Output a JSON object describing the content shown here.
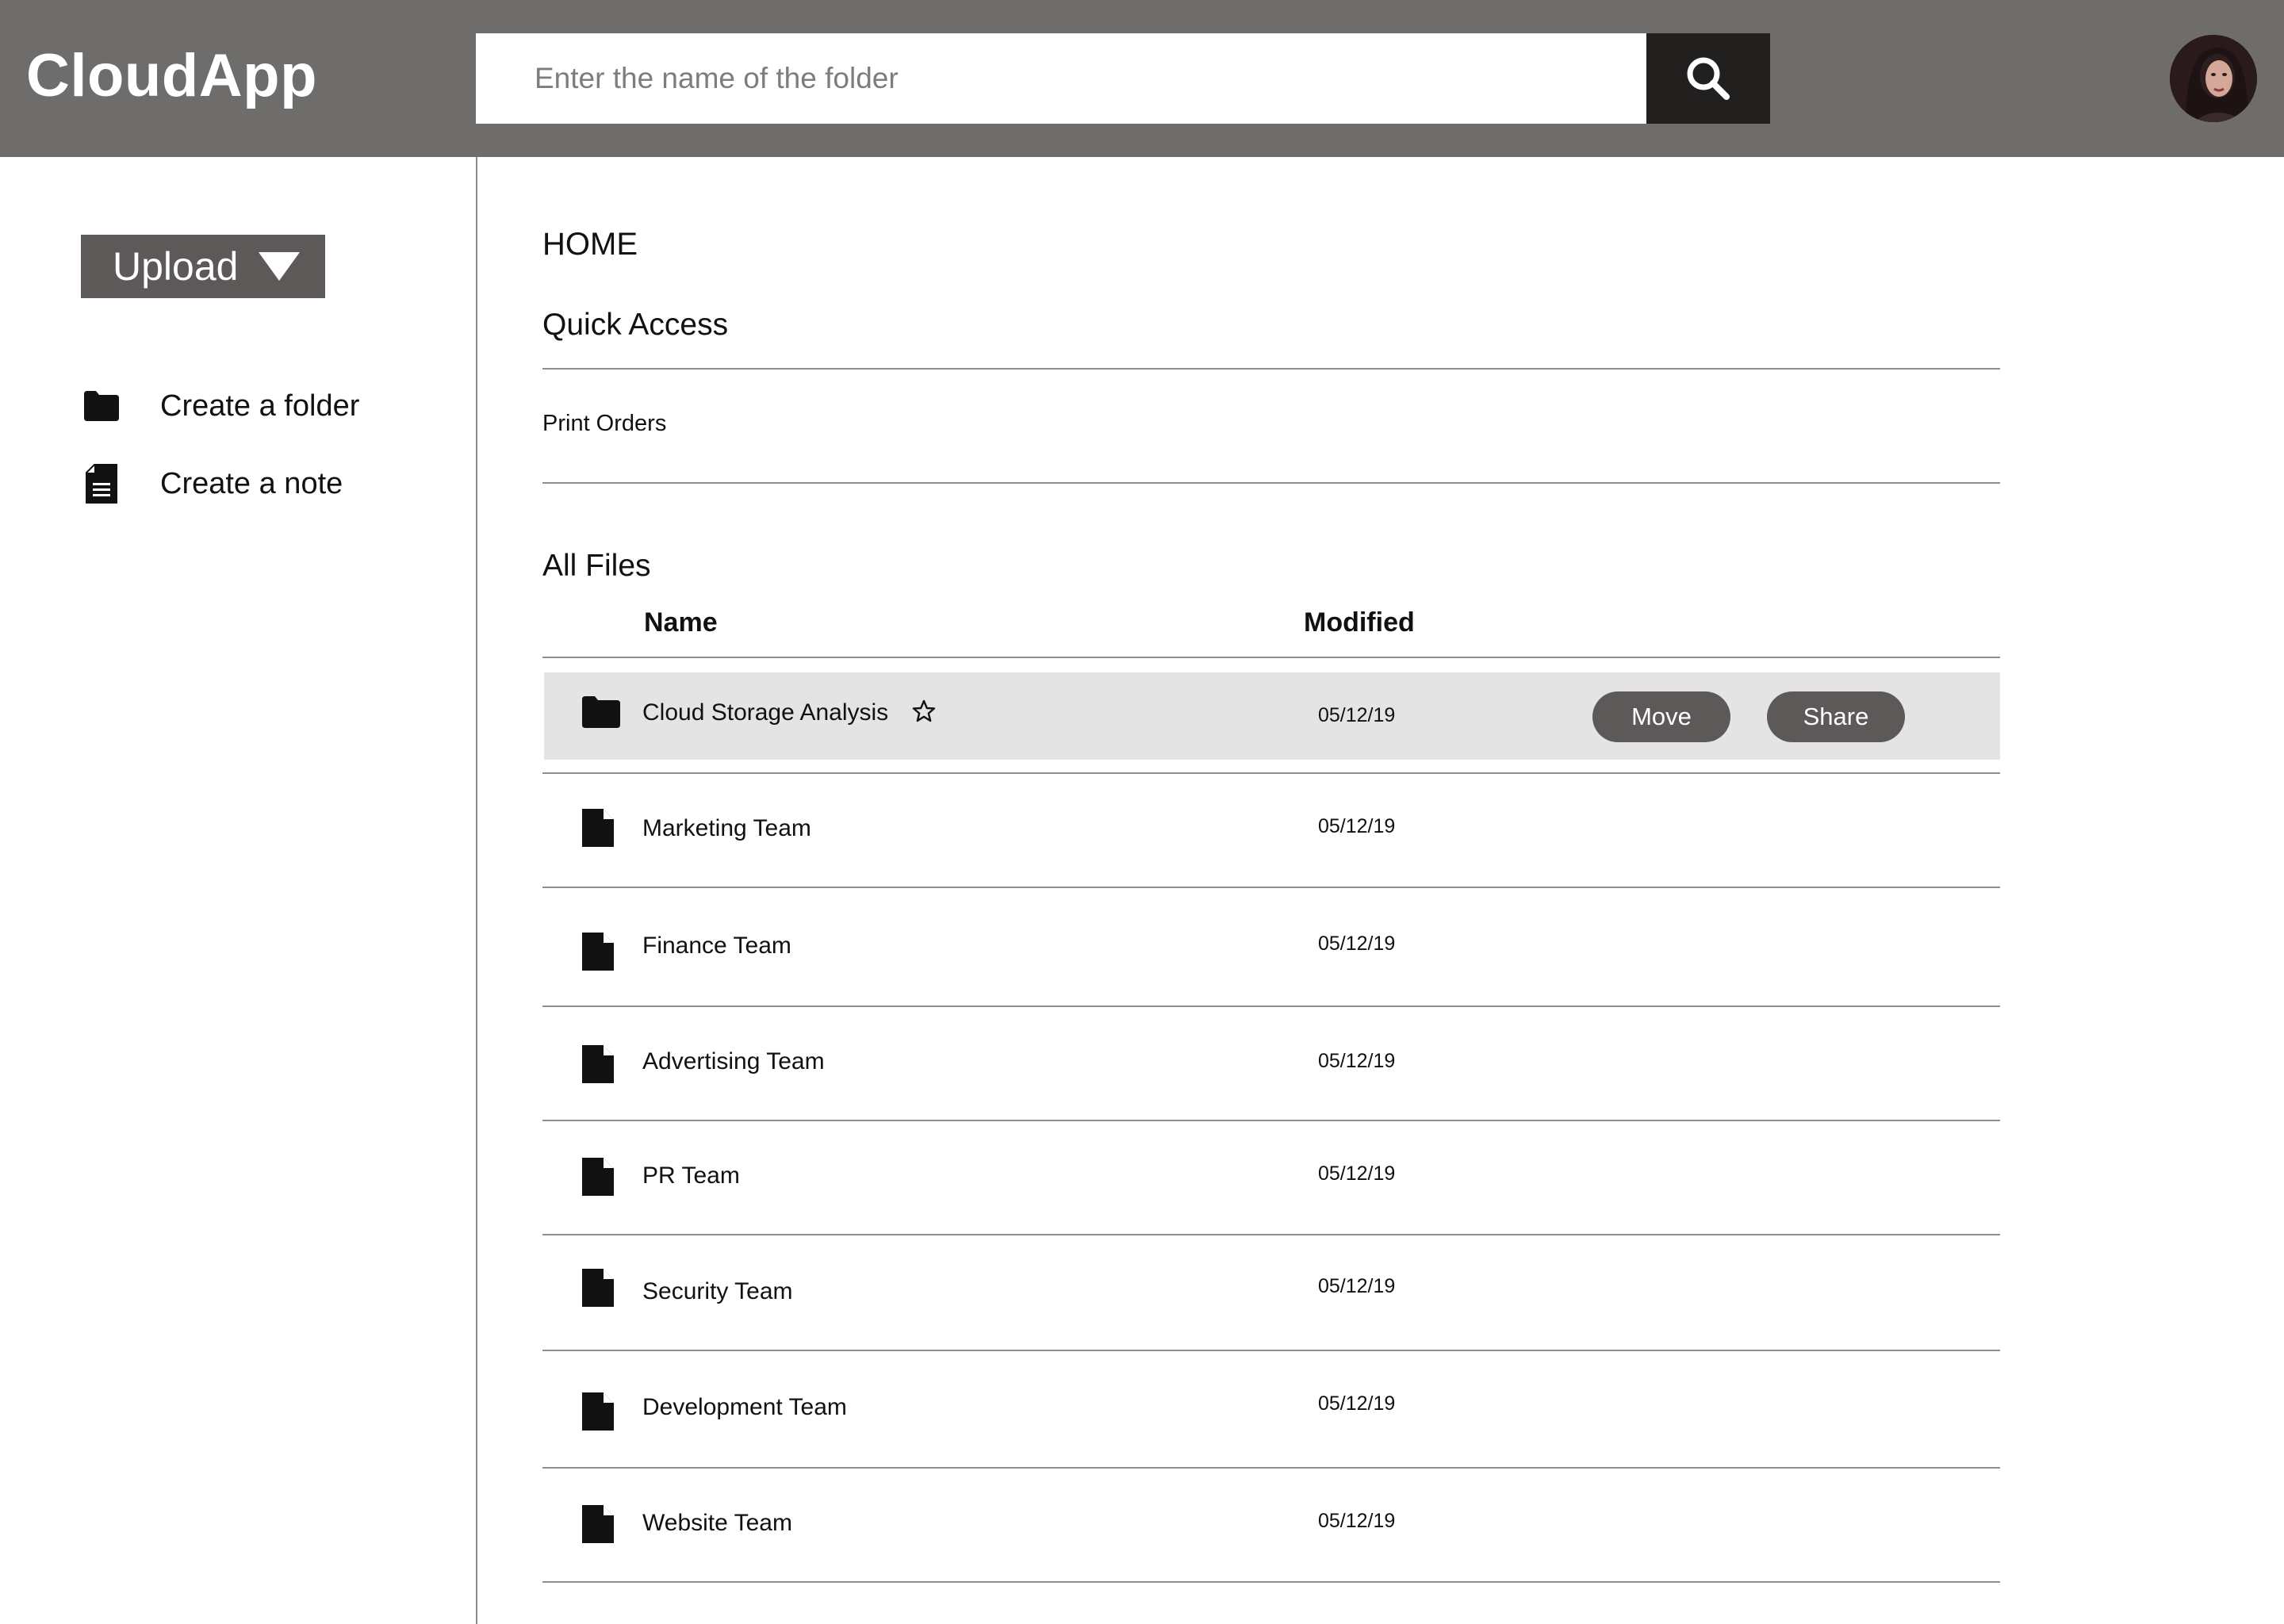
{
  "header": {
    "brand": "CloudApp",
    "search_placeholder": "Enter the name of the folder",
    "search_icon": "search-icon",
    "avatar": "user-avatar"
  },
  "sidebar": {
    "upload_label": "Upload",
    "upload_icon": "caret-down-icon",
    "actions": [
      {
        "label": "Create a folder",
        "icon": "folder-icon"
      },
      {
        "label": "Create a note",
        "icon": "note-icon"
      }
    ]
  },
  "main": {
    "home_title": "HOME",
    "quick_access": {
      "title": "Quick Access",
      "items": [
        "Print Orders"
      ]
    },
    "all_files": {
      "title": "All Files",
      "columns": {
        "name": "Name",
        "modified": "Modified"
      },
      "rows": [
        {
          "name": "Cloud Storage Analysis",
          "modified": "05/12/19",
          "icon": "folder-icon",
          "starred_icon": "star-outline-icon",
          "selected": true,
          "actions": [
            "Move",
            "Share"
          ]
        },
        {
          "name": "Marketing Team",
          "modified": "05/12/19",
          "icon": "document-icon"
        },
        {
          "name": "Finance Team",
          "modified": "05/12/19",
          "icon": "document-icon"
        },
        {
          "name": "Advertising Team",
          "modified": "05/12/19",
          "icon": "document-icon"
        },
        {
          "name": "PR Team",
          "modified": "05/12/19",
          "icon": "document-icon"
        },
        {
          "name": "Security Team",
          "modified": "05/12/19",
          "icon": "document-icon"
        },
        {
          "name": "Development Team",
          "modified": "05/12/19",
          "icon": "document-icon"
        },
        {
          "name": "Website Team",
          "modified": "05/12/19",
          "icon": "document-icon"
        }
      ]
    }
  },
  "colors": {
    "header_bg": "#6e6d6b",
    "search_button_bg": "#221f1f",
    "button_bg": "#5d5958",
    "selected_row_bg": "#e4e4e4",
    "divider": "#8f8f8f"
  }
}
